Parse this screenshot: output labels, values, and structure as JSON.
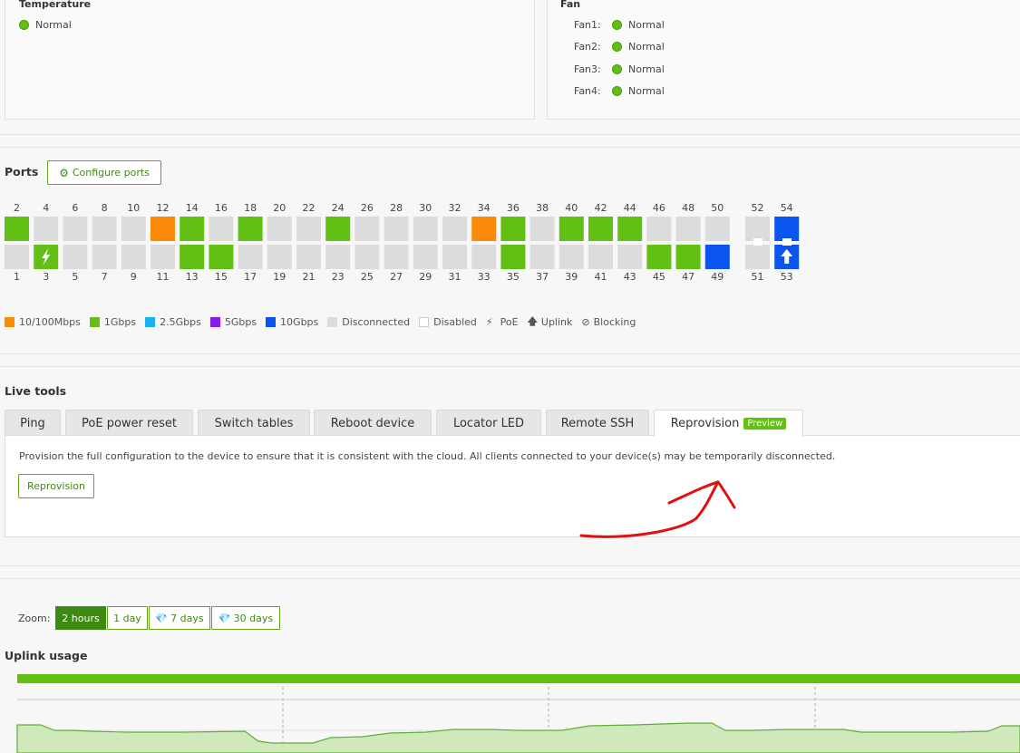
{
  "temperature": {
    "title": "Temperature",
    "status": "Normal"
  },
  "fan": {
    "title": "Fan",
    "items": [
      {
        "label": "Fan1:",
        "status": "Normal"
      },
      {
        "label": "Fan2:",
        "status": "Normal"
      },
      {
        "label": "Fan3:",
        "status": "Normal"
      },
      {
        "label": "Fan4:",
        "status": "Normal"
      }
    ]
  },
  "ports": {
    "title": "Ports",
    "configure_label": "Configure ports",
    "colors": {
      "10/100Mbps": "#fb8a0a",
      "1Gbps": "#62bf13",
      "2.5Gbps": "#1ab1f0",
      "5Gbps": "#8b1be8",
      "10Gbps": "#0a55f0",
      "Disconnected": "#dcdcdc",
      "Disabled": "#ffffff"
    },
    "top_row": [
      {
        "num": "2",
        "status": "1Gbps"
      },
      {
        "num": "4",
        "status": "Disconnected"
      },
      {
        "num": "6",
        "status": "Disconnected"
      },
      {
        "num": "8",
        "status": "Disconnected"
      },
      {
        "num": "10",
        "status": "Disconnected"
      },
      {
        "num": "12",
        "status": "10/100Mbps"
      },
      {
        "num": "14",
        "status": "1Gbps"
      },
      {
        "num": "16",
        "status": "Disconnected"
      },
      {
        "num": "18",
        "status": "1Gbps"
      },
      {
        "num": "20",
        "status": "Disconnected"
      },
      {
        "num": "22",
        "status": "Disconnected"
      },
      {
        "num": "24",
        "status": "1Gbps"
      },
      {
        "num": "26",
        "status": "Disconnected"
      },
      {
        "num": "28",
        "status": "Disconnected"
      },
      {
        "num": "30",
        "status": "Disconnected"
      },
      {
        "num": "32",
        "status": "Disconnected"
      },
      {
        "num": "34",
        "status": "10/100Mbps"
      },
      {
        "num": "36",
        "status": "1Gbps"
      },
      {
        "num": "38",
        "status": "Disconnected"
      },
      {
        "num": "40",
        "status": "1Gbps"
      },
      {
        "num": "42",
        "status": "1Gbps"
      },
      {
        "num": "44",
        "status": "1Gbps"
      },
      {
        "num": "46",
        "status": "Disconnected"
      },
      {
        "num": "48",
        "status": "Disconnected"
      },
      {
        "num": "50",
        "status": "Disconnected"
      },
      {
        "num": "52",
        "status": "Disconnected",
        "sfp": true
      },
      {
        "num": "54",
        "status": "10Gbps",
        "sfp": true
      }
    ],
    "bottom_row": [
      {
        "num": "1",
        "status": "Disconnected"
      },
      {
        "num": "3",
        "status": "1Gbps",
        "poe": true
      },
      {
        "num": "5",
        "status": "Disconnected"
      },
      {
        "num": "7",
        "status": "Disconnected"
      },
      {
        "num": "9",
        "status": "Disconnected"
      },
      {
        "num": "11",
        "status": "Disconnected"
      },
      {
        "num": "13",
        "status": "1Gbps"
      },
      {
        "num": "15",
        "status": "1Gbps"
      },
      {
        "num": "17",
        "status": "Disconnected"
      },
      {
        "num": "19",
        "status": "Disconnected"
      },
      {
        "num": "21",
        "status": "Disconnected"
      },
      {
        "num": "23",
        "status": "Disconnected"
      },
      {
        "num": "25",
        "status": "Disconnected"
      },
      {
        "num": "27",
        "status": "Disconnected"
      },
      {
        "num": "29",
        "status": "Disconnected"
      },
      {
        "num": "31",
        "status": "Disconnected"
      },
      {
        "num": "33",
        "status": "Disconnected"
      },
      {
        "num": "35",
        "status": "1Gbps"
      },
      {
        "num": "37",
        "status": "Disconnected"
      },
      {
        "num": "39",
        "status": "Disconnected"
      },
      {
        "num": "41",
        "status": "Disconnected"
      },
      {
        "num": "43",
        "status": "Disconnected"
      },
      {
        "num": "45",
        "status": "1Gbps"
      },
      {
        "num": "47",
        "status": "1Gbps"
      },
      {
        "num": "49",
        "status": "10Gbps"
      },
      {
        "num": "51",
        "status": "Disconnected",
        "sfp": true
      },
      {
        "num": "53",
        "status": "10Gbps",
        "sfp": true,
        "uplink": true
      }
    ],
    "legend": {
      "speed_10_100": "10/100Mbps",
      "speed_1g": "1Gbps",
      "speed_2_5g": "2.5Gbps",
      "speed_5g": "5Gbps",
      "speed_10g": "10Gbps",
      "disconnected": "Disconnected",
      "disabled": "Disabled",
      "poe": "PoE",
      "uplink": "Uplink",
      "blocking": "Blocking"
    }
  },
  "live_tools": {
    "title": "Live tools",
    "tabs": [
      {
        "label": "Ping"
      },
      {
        "label": "PoE power reset"
      },
      {
        "label": "Switch tables"
      },
      {
        "label": "Reboot device"
      },
      {
        "label": "Locator LED"
      },
      {
        "label": "Remote SSH"
      },
      {
        "label": "Reprovision",
        "badge": "Preview",
        "active": true
      }
    ],
    "panel_text": "Provision the full configuration to the device to ensure that it is consistent with the cloud. All clients connected to your device(s) may be temporarily disconnected.",
    "action_label": "Reprovision"
  },
  "zoom": {
    "label": "Zoom:",
    "options": [
      {
        "label": "2 hours",
        "active": true
      },
      {
        "label": "1 day"
      },
      {
        "label": "7 days",
        "premium": true
      },
      {
        "label": "30 days",
        "premium": true
      }
    ]
  },
  "uplink": {
    "title": "Uplink usage",
    "bar_color": "#62bf13",
    "area_color": "#cfe9bd",
    "line_color": "#5fae35"
  }
}
